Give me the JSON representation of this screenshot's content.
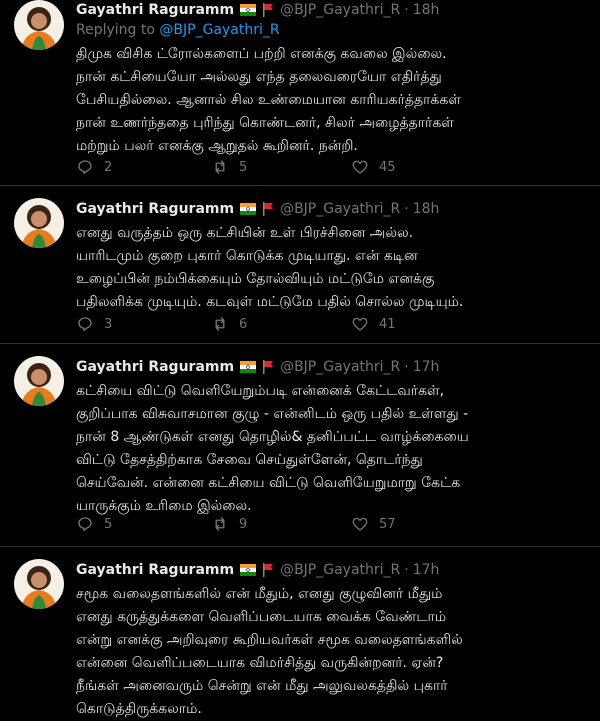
{
  "tweets": [
    {
      "name": "Gayathri Raguramm",
      "handle": "@BJP_Gayathri_R",
      "separator": "·",
      "time": "18h",
      "replying_prefix": "Replying to",
      "replying_to": "@BJP_Gayathri_R",
      "lines": [
        "திமுக விசிக ட்ரோல்களைப் பற்றி எனக்கு கவலை இல்லை.",
        "நான் கட்சியையோ அல்லது எந்த தலைவரையோ எதிர்த்து",
        "பேசியதில்லை. ஆனால் சில உண்மையான காரியகர்த்தாக்கள்",
        "நான் உணர்ந்ததை புரிந்து கொண்டனர், சிலர் அழைத்தார்கள்",
        "மற்றும் பலர் எனக்கு ஆறுதல் கூறினர்.  நன்றி."
      ],
      "replies": "2",
      "retweets": "5",
      "likes": "45"
    },
    {
      "name": "Gayathri Raguramm",
      "handle": "@BJP_Gayathri_R",
      "separator": "·",
      "time": "18h",
      "lines": [
        "எனது வருத்தம் ஒரு கட்சியின் உள் பிரச்சினை அல்ல.",
        "யாரிடமும் குறை புகார் கொடுக்க முடியாது. என் கடின",
        "உழைப்பின் நம்பிக்கையும் தோல்வியும் மட்டுமே எனக்கு",
        "பதிலளிக்க முடியும். கடவுள் மட்டுமே பதில் சொல்ல முடியும்."
      ],
      "replies": "3",
      "retweets": "6",
      "likes": "41"
    },
    {
      "name": "Gayathri Raguramm",
      "handle": "@BJP_Gayathri_R",
      "separator": "·",
      "time": "17h",
      "lines": [
        "கட்சியை விட்டு வெளியேறும்படி என்னைக் கேட்டவர்கள்,",
        "குறிப்பாக விசுவாசமான குழு - என்னிடம் ஒரு பதில் உள்ளது -",
        "நான் 8 ஆண்டுகள் எனது தொழில்& தனிப்பட்ட வாழ்க்கையை",
        "விட்டு தேசத்திற்காக சேவை செய்துள்ளேன், தொடர்ந்து",
        "செய்வேன். என்னை கட்சியை விட்டு வெளியேறுமாறு கேட்க",
        "யாருக்கும் உரிமை இல்லை."
      ],
      "replies": "5",
      "retweets": "9",
      "likes": "57"
    },
    {
      "name": "Gayathri Raguramm",
      "handle": "@BJP_Gayathri_R",
      "separator": "·",
      "time": "17h",
      "lines": [
        "சமூக வலைதளங்களில் என் மீதும், எனது குழுவினர் மீதும்",
        "எனது கருத்துக்களை வெளிப்படையாக வைக்க வேண்டாம்",
        "என்று எனக்கு அறிவுரை கூறியவர்கள் சமூக வலைதளங்களில்",
        "என்னை வெளிப்படையாக விமர்சித்து வருகின்றனர். ஏன்?",
        "நீங்கள் அனைவரும் சென்று என் மீது அலுவலகத்தில் புகார்",
        "கொடுத்திருக்கலாம்."
      ]
    }
  ],
  "colors": {
    "background": "#000000",
    "text": "#e7e9ea",
    "muted": "#71767b",
    "link": "#1d9bf0",
    "divider": "#2f3336"
  },
  "icons": [
    "reply-icon",
    "retweet-icon",
    "like-icon",
    "india-flag-icon",
    "red-flag-icon"
  ]
}
